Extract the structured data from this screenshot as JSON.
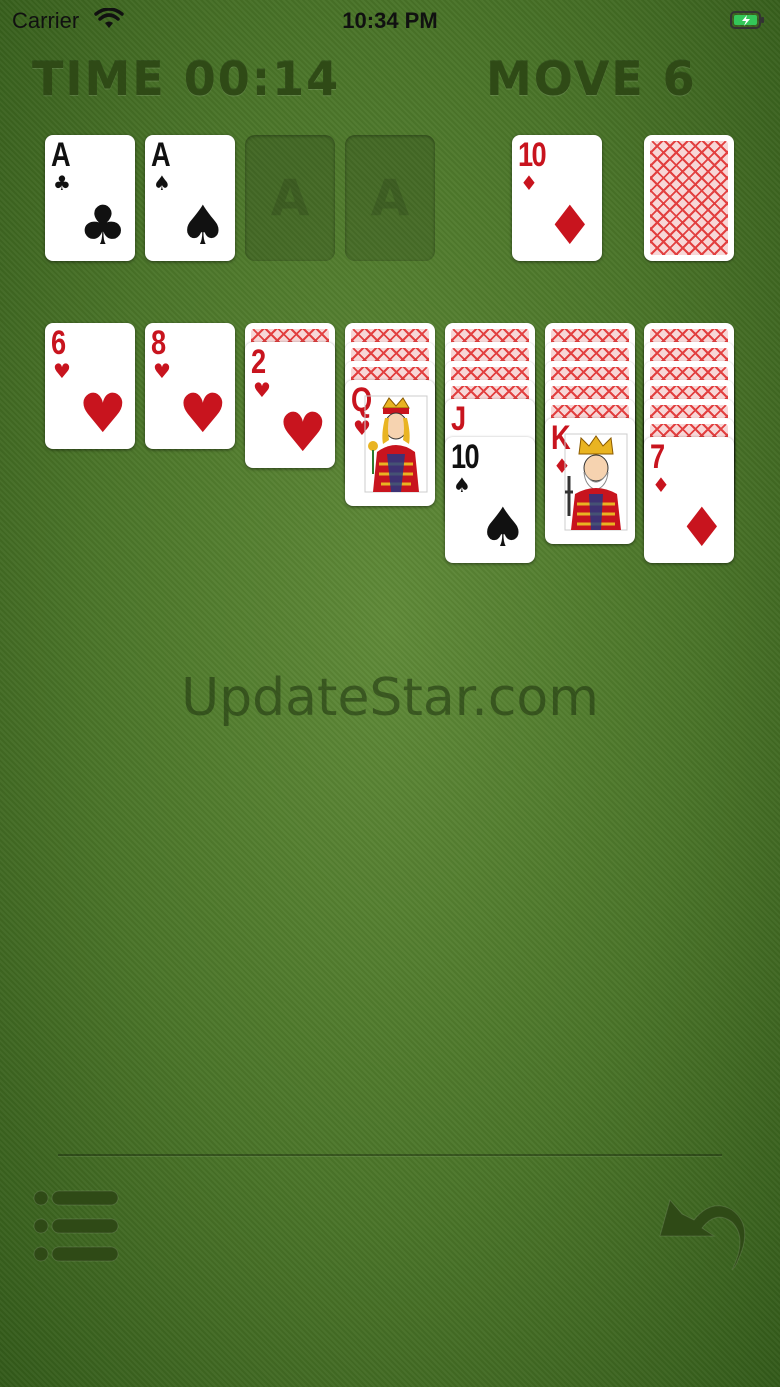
{
  "status_bar": {
    "carrier": "Carrier",
    "time": "10:34 PM"
  },
  "hud": {
    "time_text": "TIME 00:14",
    "move_text": "MOVE 6"
  },
  "foundations": [
    {
      "rank": "A",
      "suit": "♣",
      "color": "black"
    },
    {
      "rank": "A",
      "suit": "♠",
      "color": "black"
    },
    {
      "placeholder": "A"
    },
    {
      "placeholder": "A"
    }
  ],
  "waste": {
    "rank": "10",
    "suit": "♦",
    "color": "red"
  },
  "tableau": [
    {
      "hidden": 0,
      "top": {
        "rank": "6",
        "suit": "♥",
        "color": "red"
      }
    },
    {
      "hidden": 0,
      "top": {
        "rank": "8",
        "suit": "♥",
        "color": "red"
      }
    },
    {
      "hidden": 1,
      "top": {
        "rank": "2",
        "suit": "♥",
        "color": "red"
      }
    },
    {
      "hidden": 3,
      "top": {
        "rank": "Q",
        "suit": "♥",
        "color": "red"
      }
    },
    {
      "hidden": 4,
      "partial": {
        "rank": "J",
        "suit": "♥",
        "color": "red"
      },
      "top": {
        "rank": "10",
        "suit": "♠",
        "color": "black"
      }
    },
    {
      "hidden": 5,
      "top": {
        "rank": "K",
        "suit": "♦",
        "color": "red"
      }
    },
    {
      "hidden": 6,
      "top": {
        "rank": "7",
        "suit": "♦",
        "color": "red"
      }
    }
  ],
  "watermark": "UpdateStar.com",
  "colors": {
    "felt": "#4a7428",
    "card_red": "#c8141e",
    "card_black": "#111111"
  },
  "icons": {
    "menu": "menu-list-icon",
    "undo": "undo-arrow-icon"
  }
}
